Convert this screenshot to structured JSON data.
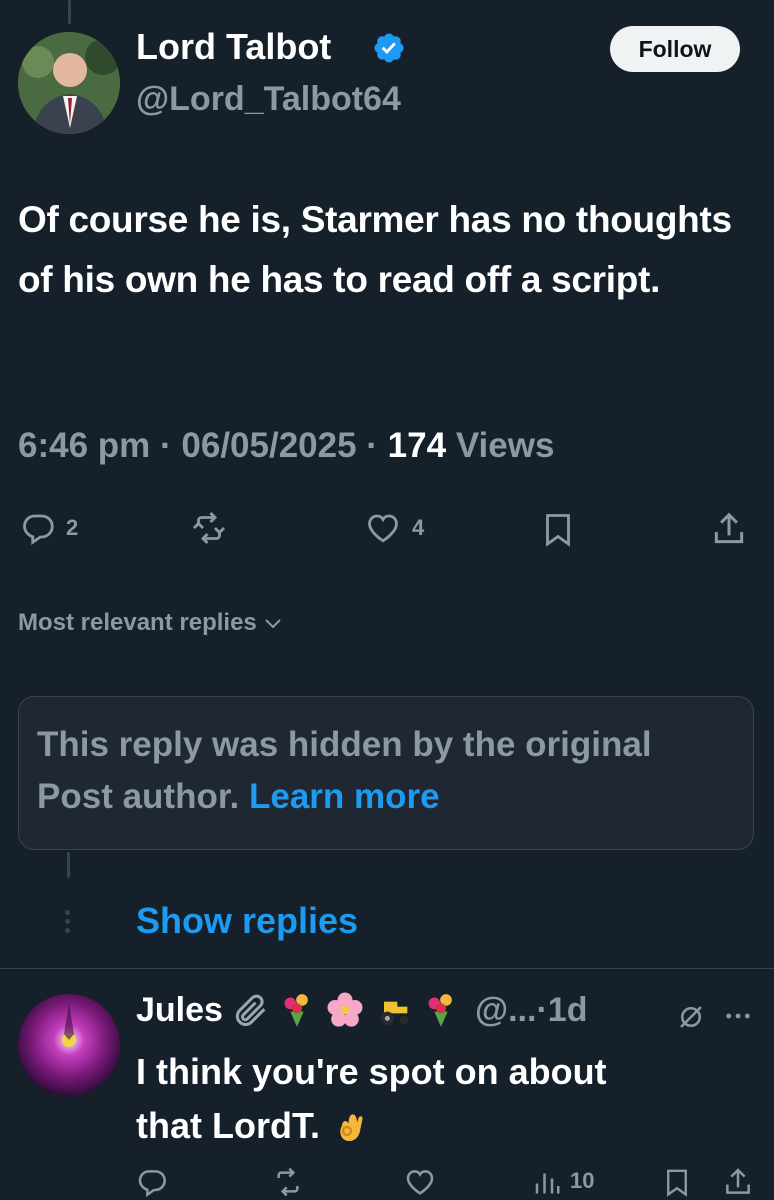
{
  "author": {
    "display_name": "Lord Talbot",
    "handle": "@Lord_Talbot64",
    "verified": true,
    "follow_label": "Follow"
  },
  "tweet": {
    "text": "Of course he is, Starmer has no thoughts of his own he has to read off a script.",
    "time": "6:46 pm",
    "date": "06/05/2025",
    "views_count": "174",
    "views_label": "Views",
    "replies_count": "2",
    "likes_count": "4"
  },
  "sort": {
    "label": "Most relevant replies"
  },
  "hidden_reply": {
    "text": "This reply was hidden by the original Post author.",
    "link_label": "Learn more"
  },
  "show_replies_label": "Show replies",
  "reply": {
    "display_name": "Jules",
    "handle": "@...",
    "time": "1d",
    "text_line1": "I think you're spot on about",
    "text_line2": "that LordT.",
    "views_count": "10",
    "hand_emoji": "👌"
  },
  "colors": {
    "background": "#15202b",
    "accent": "#1d9bf0",
    "muted": "#8b98a5",
    "border": "#38444d"
  }
}
